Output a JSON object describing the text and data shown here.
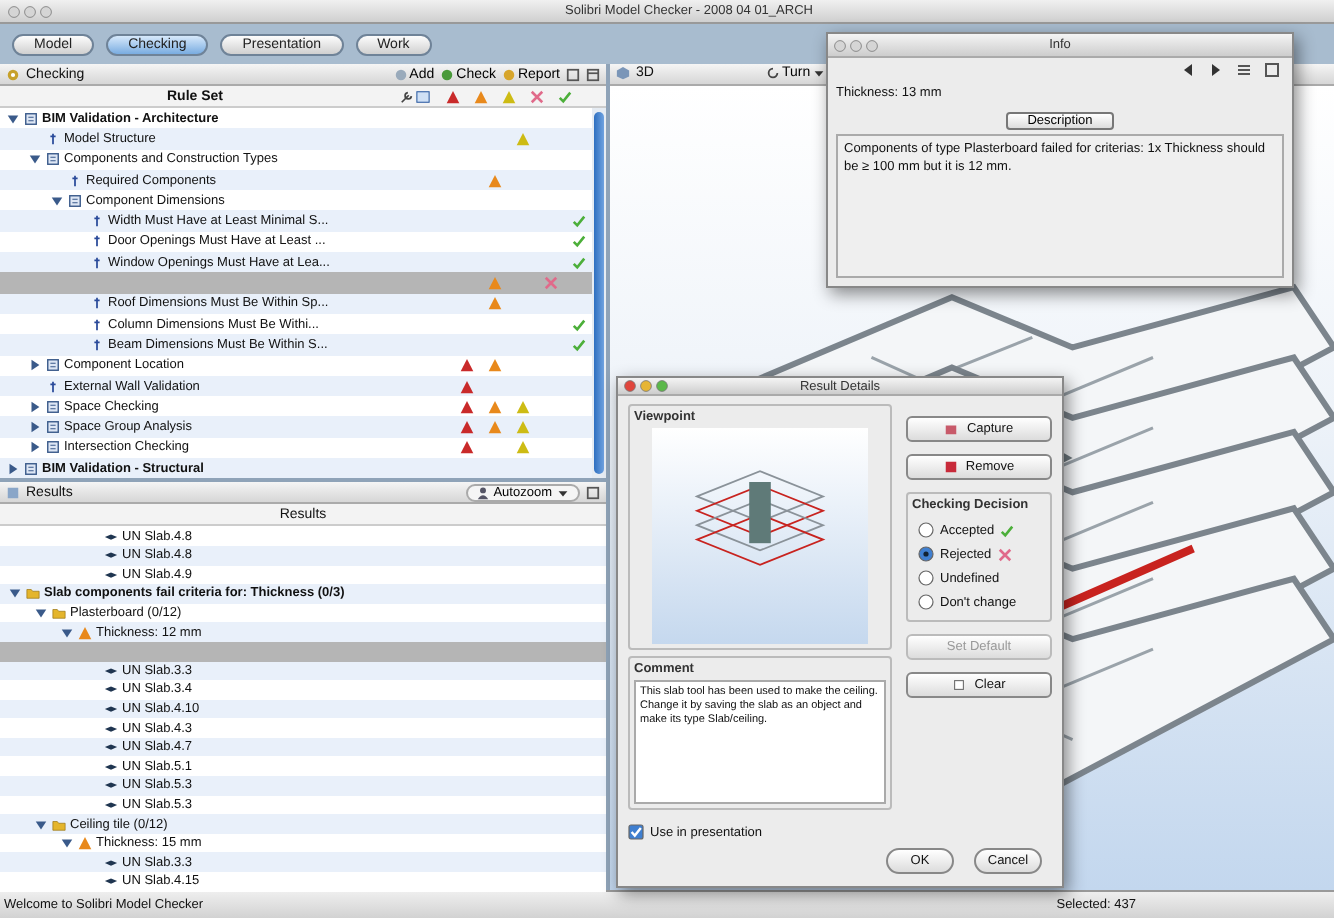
{
  "window": {
    "title": "Solibri Model Checker - 2008 04 01_ARCH"
  },
  "tabs": [
    {
      "label": "Model",
      "selected": false
    },
    {
      "label": "Checking",
      "selected": true
    },
    {
      "label": "Presentation",
      "selected": false
    },
    {
      "label": "Work",
      "selected": false
    }
  ],
  "checking": {
    "title": "Checking",
    "actions": [
      "Add",
      "Check",
      "Report"
    ],
    "column": "Rule Set",
    "rows": [
      {
        "kind": "ruleset",
        "label": "BIM Validation - Architecture",
        "expanded": true,
        "selected": false,
        "children": [
          {
            "kind": "rule",
            "label": "Model Structure",
            "selected": false,
            "issues": [
              {
                "kind": "low"
              }
            ]
          },
          {
            "kind": "ruleset",
            "label": "Components and Construction Types",
            "expanded": true,
            "selected": false,
            "children": [
              {
                "kind": "rule",
                "label": "Required Components",
                "selected": false,
                "issues": [
                  {
                    "kind": "medium"
                  }
                ]
              },
              {
                "kind": "ruleset",
                "label": "Component Dimensions",
                "expanded": true,
                "selected": false,
                "children": [
                  {
                    "kind": "rule",
                    "label": "Width Must Have at Least Minimal S...",
                    "selected": false,
                    "issues": [
                      {
                        "kind": "accepted"
                      }
                    ]
                  },
                  {
                    "kind": "rule",
                    "label": "Door Openings Must Have at Least ...",
                    "selected": false,
                    "issues": [
                      {
                        "kind": "accepted"
                      }
                    ]
                  },
                  {
                    "kind": "rule",
                    "label": "Window Openings Must Have at Lea...",
                    "selected": false,
                    "issues": [
                      {
                        "kind": "accepted"
                      }
                    ]
                  },
                  {
                    "kind": "rule",
                    "selected": true,
                    "issues": [
                      {
                        "kind": "medium"
                      },
                      {
                        "kind": "rejected"
                      }
                    ]
                  },
                  {
                    "kind": "rule",
                    "label": "Roof Dimensions Must Be Within Sp...",
                    "selected": false,
                    "issues": [
                      {
                        "kind": "medium"
                      }
                    ]
                  },
                  {
                    "kind": "rule",
                    "label": "Column Dimensions Must Be Withi...",
                    "selected": false,
                    "issues": [
                      {
                        "kind": "accepted"
                      }
                    ]
                  },
                  {
                    "kind": "rule",
                    "label": "Beam Dimensions Must Be Within S...",
                    "selected": false,
                    "issues": [
                      {
                        "kind": "accepted"
                      }
                    ]
                  }
                ]
              }
            ]
          },
          {
            "kind": "ruleset",
            "label": "Component Location",
            "expanded": false,
            "selected": false,
            "issues": [
              {
                "kind": "high"
              },
              {
                "kind": "medium"
              }
            ]
          },
          {
            "kind": "rule",
            "label": "External Wall Validation",
            "selected": false,
            "issues": [
              {
                "kind": "high"
              }
            ]
          },
          {
            "kind": "ruleset",
            "label": "Space Checking",
            "expanded": false,
            "selected": false,
            "issues": [
              {
                "kind": "high"
              },
              {
                "kind": "medium"
              },
              {
                "kind": "low"
              }
            ]
          },
          {
            "kind": "ruleset",
            "label": "Space Group Analysis",
            "expanded": false,
            "selected": false,
            "issues": [
              {
                "kind": "high"
              },
              {
                "kind": "medium"
              },
              {
                "kind": "low"
              }
            ]
          },
          {
            "kind": "ruleset",
            "label": "Intersection Checking",
            "expanded": false,
            "selected": false,
            "issues": [
              {
                "kind": "high"
              },
              {
                "kind": "low"
              }
            ]
          }
        ]
      },
      {
        "kind": "ruleset",
        "label": "BIM Validation - Structural",
        "expanded": false,
        "selected": false
      }
    ]
  },
  "results": {
    "title": "Results",
    "zoom": "Autozoom",
    "column": "Results",
    "rows": [
      {
        "kind": "item",
        "label": "UN Slab.4.8",
        "selected": false
      },
      {
        "kind": "item",
        "label": "UN Slab.4.8",
        "selected": false
      },
      {
        "kind": "item",
        "label": "UN Slab.4.9",
        "selected": false
      },
      {
        "kind": "group",
        "label": "Slab components fail criteria for: Thickness (0/3)",
        "expanded": true,
        "selected": false,
        "children": [
          {
            "kind": "group",
            "label": "Plasterboard (0/12)",
            "expanded": true,
            "selected": false,
            "children": [
              {
                "kind": "criterion",
                "label": "Thickness: 12 mm",
                "expanded": true,
                "selected": false,
                "children": [
                  {
                    "kind": "item",
                    "selected": true
                  },
                  {
                    "kind": "item",
                    "label": "UN Slab.3.3",
                    "selected": false
                  },
                  {
                    "kind": "item",
                    "label": "UN Slab.3.4",
                    "selected": false
                  },
                  {
                    "kind": "item",
                    "label": "UN Slab.4.10",
                    "selected": false
                  },
                  {
                    "kind": "item",
                    "label": "UN Slab.4.3",
                    "selected": false
                  },
                  {
                    "kind": "item",
                    "label": "UN Slab.4.7",
                    "selected": false
                  },
                  {
                    "kind": "item",
                    "label": "UN Slab.5.1",
                    "selected": false
                  },
                  {
                    "kind": "item",
                    "label": "UN Slab.5.3",
                    "selected": false
                  },
                  {
                    "kind": "item",
                    "label": "UN Slab.5.3",
                    "selected": false
                  }
                ]
              }
            ]
          },
          {
            "kind": "group",
            "label": "Ceiling tile (0/12)",
            "expanded": true,
            "selected": false,
            "children": [
              {
                "kind": "criterion",
                "label": "Thickness: 15 mm",
                "expanded": true,
                "selected": false,
                "children": [
                  {
                    "kind": "item",
                    "label": "UN Slab.3.3",
                    "selected": false
                  },
                  {
                    "kind": "item",
                    "label": "UN Slab.4.15",
                    "selected": false
                  }
                ]
              }
            ]
          }
        ]
      }
    ]
  },
  "view": {
    "title": "3D",
    "turn": "Turn"
  },
  "info": {
    "title": "Info",
    "heading": "Thickness: 13 mm",
    "tab": "Description",
    "text": "Components of type Plasterboard failed for criterias: 1x Thickness should be ≥ 100 mm but it is 12 mm."
  },
  "dialog": {
    "title": "Result Details",
    "viewpoint_label": "Viewpoint",
    "capture": "Capture",
    "remove": "Remove",
    "decision_label": "Checking Decision",
    "decisions": [
      {
        "kind": "accepted",
        "label": "Accepted",
        "selected": false
      },
      {
        "kind": "rejected",
        "label": "Rejected",
        "selected": true
      },
      {
        "kind": "undefined",
        "label": "Undefined",
        "selected": false
      },
      {
        "kind": "unchanged",
        "label": "Don't change",
        "selected": false
      }
    ],
    "set_default": {
      "label": "Set Default",
      "disabled": true
    },
    "clear": "Clear",
    "comment_label": "Comment",
    "comment": "This slab tool has been used to make the ceiling. Change it by saving the slab as an object and make its type Slab/ceiling.",
    "use_in_presentation": {
      "label": "Use in presentation",
      "checked": true
    },
    "buttons": [
      "OK",
      "Cancel"
    ]
  },
  "status_bar": {
    "message": "Welcome to Solibri Model Checker",
    "selected": "Selected: 437"
  }
}
